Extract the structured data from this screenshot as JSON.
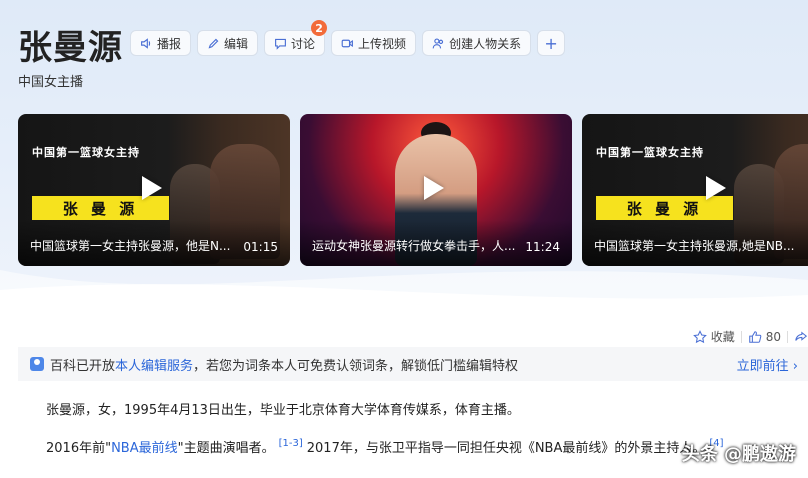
{
  "header": {
    "title": "张曼源",
    "subtitle": "中国女主播"
  },
  "toolbar": {
    "broadcast": "播报",
    "edit": "编辑",
    "discuss": "讨论",
    "discuss_badge": "2",
    "upload_video": "上传视频",
    "create_relation": "创建人物关系",
    "plus": "+"
  },
  "videos": [
    {
      "headline": "中国第一篮球女主持",
      "name_banner": "张 曼 源",
      "caption": "中国篮球第一女主持张曼源，他是N...",
      "duration": "01:15"
    },
    {
      "caption": "运动女神张曼源转行做女拳击手，人...",
      "duration": "11:24"
    },
    {
      "headline": "中国第一篮球女主持",
      "name_banner": "张 曼 源",
      "caption": "中国篮球第一女主持张曼源,她是NB...",
      "duration": ""
    }
  ],
  "stats": {
    "collect": "收藏",
    "likes": "80"
  },
  "notice": {
    "prefix": "百科已开放",
    "link": "本人编辑服务",
    "suffix": "，若您为词条本人可免费认领词条，解锁低门槛编辑特权",
    "action": "立即前往"
  },
  "paragraphs": {
    "p1": "张曼源，女，1995年4月13日出生，毕业于北京体育大学体育传媒系，体育主播。",
    "p2_a": "2016年前\"",
    "p2_link": "NBA最前线",
    "p2_b": "\"主题曲演唱者。",
    "p2_ref1": "[1-3]",
    "p2_c": "2017年，与张卫平指导一同担任央视《NBA最前线》的外景主持人。",
    "p2_ref2": "[4]"
  },
  "watermark": "头条 @鹏遨游",
  "colors": {
    "link": "#2b66d9",
    "badge": "#f26b3a",
    "banner_yellow": "#f6e21e",
    "hero_bg": "#dfeaf8"
  }
}
